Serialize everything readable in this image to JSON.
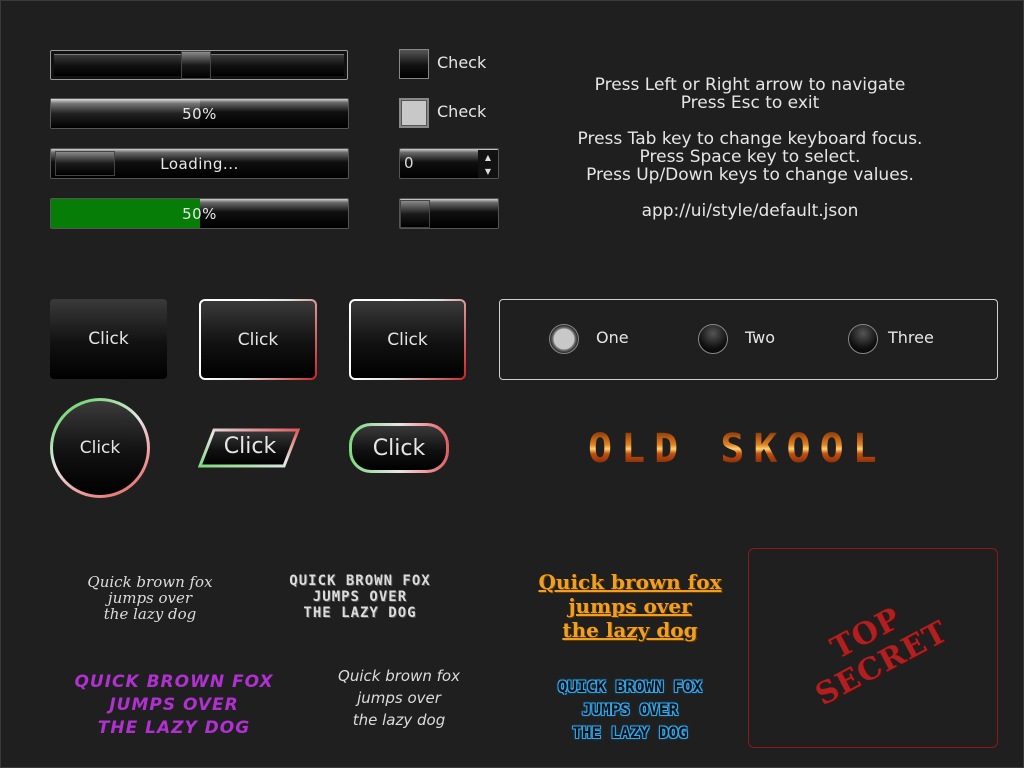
{
  "slider": {
    "value_fraction": 0.49
  },
  "progress_bar": {
    "label": "50%",
    "value_fraction": 0.5
  },
  "loading_bar": {
    "label": "Loading..."
  },
  "green_progress": {
    "label": "50%",
    "value_fraction": 0.5
  },
  "checkboxes": [
    {
      "label": "Check",
      "checked": false
    },
    {
      "label": "Check",
      "checked": true
    }
  ],
  "spinner": {
    "value": "0",
    "up_icon": "triangle-up-icon",
    "down_icon": "triangle-down-icon"
  },
  "mini_slider": {
    "value_fraction": 0.0
  },
  "help": {
    "line1": "Press Left or Right arrow to navigate\nPress Esc to exit",
    "line2": "Press Tab key to change keyboard focus.\nPress Space key to select.\nPress Up/Down keys to change values.",
    "line3": "app://ui/style/default.json"
  },
  "buttons": {
    "plain": "Click",
    "outlined_1": "Click",
    "outlined_2": "Click",
    "circle": "Click",
    "parallelogram": "Click",
    "pill": "Click"
  },
  "radio_group": {
    "options": [
      {
        "label": "One",
        "selected": true
      },
      {
        "label": "Two",
        "selected": false
      },
      {
        "label": "Three",
        "selected": false
      }
    ]
  },
  "oldskool_text": "OLD SKOOL",
  "samples": {
    "handwritten": "Quick brown fox\njumps over\nthe lazy dog",
    "blocky": "QUICK BROWN FOX\nJUMPS OVER\nTHE LAZY DOG",
    "orange": "Quick brown fox\njumps over\nthe lazy dog",
    "purple": "QUICK BROWN FOX\nJUMPS OVER\nTHE LAZY DOG",
    "italic": "Quick brown fox\njumps over\nthe lazy dog",
    "blue": "QUICK BROWN FOX\nJUMPS OVER\nTHE LAZY DOG"
  },
  "stamp": "TOP\nSECRET",
  "colors": {
    "background": "#1f1f1f",
    "progress_green": "#067d06",
    "stamp_red": "#b02020",
    "orange_text": "#f0a020",
    "purple_text": "#b030d0",
    "blue_text": "#30a8f0"
  }
}
